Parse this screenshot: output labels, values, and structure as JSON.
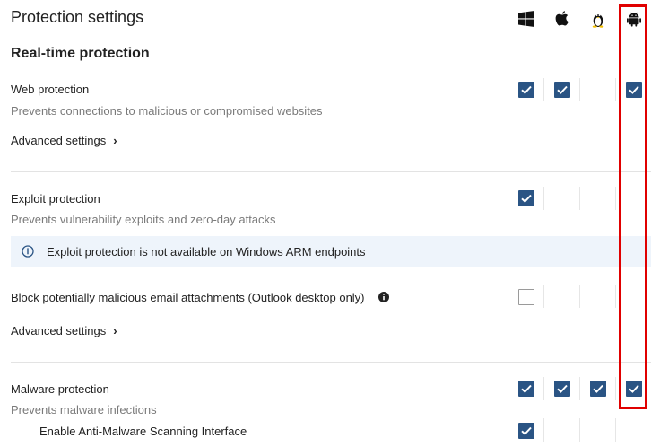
{
  "page": {
    "title": "Protection settings",
    "section_title": "Real-time protection"
  },
  "os_columns": [
    "windows-icon",
    "apple-icon",
    "linux-icon",
    "android-icon"
  ],
  "colors": {
    "checkbox_checked": "#2a5484",
    "notice_background": "#eef4fb",
    "highlight": "#e00000"
  },
  "web_protection": {
    "label": "Web protection",
    "description": "Prevents connections to malicious or compromised websites",
    "advanced": "Advanced settings",
    "checks": {
      "windows": true,
      "mac": true,
      "linux": null,
      "android": true
    }
  },
  "exploit_protection": {
    "label": "Exploit protection",
    "description": "Prevents vulnerability exploits and zero-day attacks",
    "checks": {
      "windows": true,
      "mac": null,
      "linux": null,
      "android": null
    }
  },
  "notice": {
    "text": "Exploit protection is not available on Windows ARM endpoints"
  },
  "email_block": {
    "label": "Block potentially malicious email attachments (Outlook desktop only)",
    "advanced": "Advanced settings",
    "checks": {
      "windows": false,
      "mac": null,
      "linux": null,
      "android": null
    }
  },
  "malware_protection": {
    "label": "Malware protection",
    "description": "Prevents malware infections",
    "checks": {
      "windows": true,
      "mac": true,
      "linux": true,
      "android": true
    }
  },
  "amsi": {
    "label": "Enable Anti-Malware Scanning Interface",
    "checks": {
      "windows": true,
      "mac": null,
      "linux": null,
      "android": null
    }
  }
}
